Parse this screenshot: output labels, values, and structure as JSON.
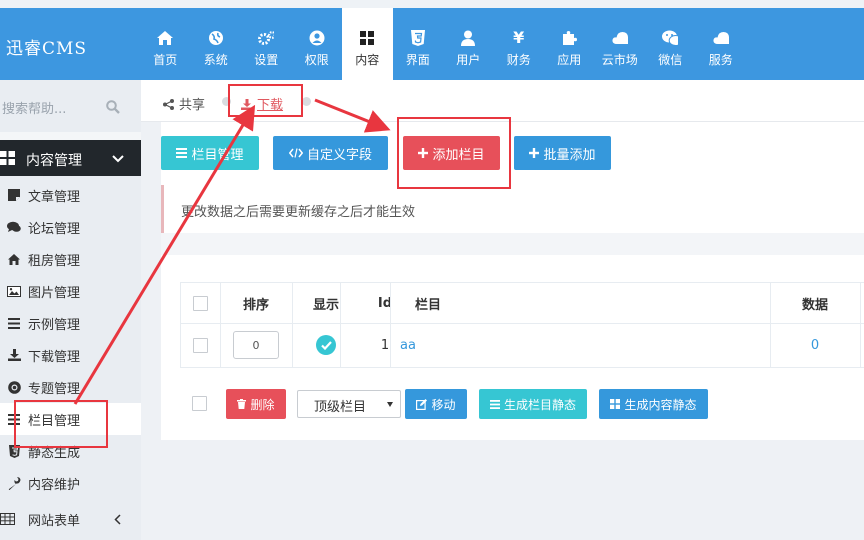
{
  "app": {
    "title": "迅睿CMS"
  },
  "nav": [
    {
      "label": "首页",
      "icon": "home-icon"
    },
    {
      "label": "系统",
      "icon": "globe-icon"
    },
    {
      "label": "设置",
      "icon": "gears-icon"
    },
    {
      "label": "权限",
      "icon": "user-circle-icon"
    },
    {
      "label": "内容",
      "icon": "grid-icon",
      "active": true
    },
    {
      "label": "界面",
      "icon": "html5-icon"
    },
    {
      "label": "用户",
      "icon": "user-icon"
    },
    {
      "label": "财务",
      "icon": "yen-icon"
    },
    {
      "label": "应用",
      "icon": "puzzle-icon"
    },
    {
      "label": "云市场",
      "icon": "cloud-icon"
    },
    {
      "label": "微信",
      "icon": "wechat-icon"
    },
    {
      "label": "服务",
      "icon": "cloud-icon"
    }
  ],
  "sidebar": {
    "search_placeholder": "搜索帮助...",
    "group": "内容管理",
    "items": [
      {
        "label": "文章管理",
        "icon": "sticky-note-icon"
      },
      {
        "label": "论坛管理",
        "icon": "comments-icon"
      },
      {
        "label": "租房管理",
        "icon": "home-icon"
      },
      {
        "label": "图片管理",
        "icon": "image-icon"
      },
      {
        "label": "示例管理",
        "icon": "list-icon"
      },
      {
        "label": "下载管理",
        "icon": "download-icon"
      },
      {
        "label": "专题管理",
        "icon": "chrome-icon"
      },
      {
        "label": "栏目管理",
        "icon": "list-icon",
        "active": true
      },
      {
        "label": "静态生成",
        "icon": "html5-icon"
      },
      {
        "label": "内容维护",
        "icon": "wrench-icon"
      }
    ],
    "footer_group": "网站表单"
  },
  "breadcrumb": {
    "share": "共享",
    "download": "下载"
  },
  "toolbar": {
    "manage": "栏目管理",
    "custom_fields": "自定义字段",
    "add": "添加栏目",
    "batch_add": "批量添加"
  },
  "notice": "更改数据之后需要更新缓存之后才能生效",
  "table": {
    "headers": [
      "排序",
      "显示",
      "Id",
      "栏目",
      "数据"
    ],
    "rows": [
      {
        "sort": "0",
        "id": "1",
        "name": "aa",
        "data": "0"
      }
    ]
  },
  "actions": {
    "delete": "删除",
    "select_value": "顶级栏目",
    "move": "移动",
    "gen_category": "生成栏目静态",
    "gen_content": "生成内容静态"
  },
  "colors": {
    "topbar": "#3d97e0",
    "cyan": "#36c6d3",
    "blue": "#3598dc",
    "red": "#e7505a",
    "annotation": "#e8363f"
  }
}
